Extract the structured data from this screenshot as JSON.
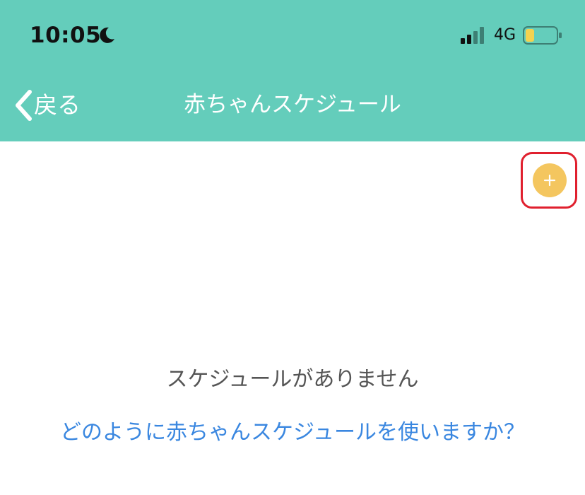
{
  "status_bar": {
    "time": "10:05",
    "network": "4G",
    "icons": [
      "moon-icon",
      "signal-icon",
      "battery-icon"
    ]
  },
  "nav": {
    "back_label": "戻る",
    "title": "赤ちゃんスケジュール"
  },
  "content": {
    "empty_message": "スケジュールがありません",
    "help_link": "どのように赤ちゃんスケジュールを使いますか？"
  },
  "colors": {
    "header": "#64cdbb",
    "add_button": "#f4c65f",
    "highlight": "#e0202e",
    "link": "#3a87e0",
    "empty_text": "#555555",
    "battery_level": "#f4d24f"
  }
}
